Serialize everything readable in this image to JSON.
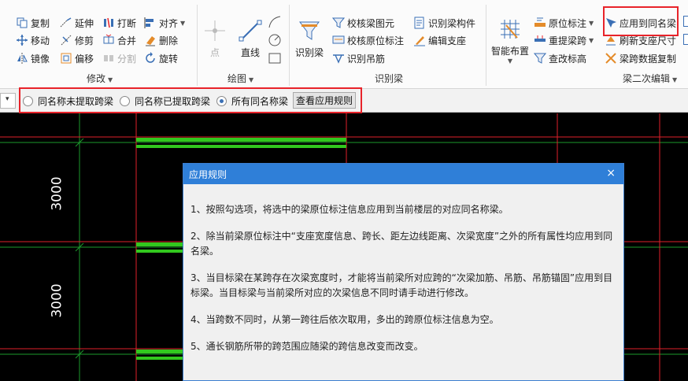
{
  "ribbon": {
    "modify": {
      "copy": "复制",
      "extend": "延伸",
      "break": "打断",
      "align": "对齐",
      "move": "移动",
      "trim": "修剪",
      "merge": "合并",
      "delete": "删除",
      "mirror": "镜像",
      "offset": "偏移",
      "split": "分割",
      "rotate": "旋转",
      "label": "修改"
    },
    "draw": {
      "point": "点",
      "line": "直线",
      "label": "绘图"
    },
    "identify": {
      "identify_beam": "识别梁",
      "check_beam_elem": "校核梁图元",
      "check_orig_label": "校核原位标注",
      "identify_hanger": "识别吊筋",
      "identify_beam_member": "识别梁构件",
      "edit_support": "编辑支座",
      "label": "识别梁"
    },
    "secondary": {
      "smart_layout": "智能布置",
      "orig_label": "原位标注",
      "reextract_span": "重提梁跨",
      "check_elevation": "查改标高",
      "apply_same_name": "应用到同名梁",
      "refresh_support": "刷新支座尺寸",
      "copy_span_data": "梁跨数据复制",
      "label": "梁二次编辑"
    }
  },
  "options": {
    "stub_glyph": "▾",
    "radio1": "同名称未提取跨梁",
    "radio2": "同名称已提取跨梁",
    "radio3": "所有同名称梁",
    "view_rules": "查看应用规则"
  },
  "canvas": {
    "dim1": "3000",
    "dim2": "3000"
  },
  "dialog": {
    "title": "应用规则",
    "close": "×",
    "rule1": "1、按照勾选项，将选中的梁原位标注信息应用到当前楼层的对应同名称梁。",
    "rule2": "2、除当前梁原位标注中“支座宽度信息、跨长、距左边线距离、次梁宽度”之外的所有属性均应用到同名梁。",
    "rule3": "3、当目标梁在某跨存在次梁宽度时，才能将当前梁所对应跨的“次梁加筋、吊筋、吊筋锚固”应用到目标梁。当目标梁与当前梁所对应的次梁信息不同时请手动进行修改。",
    "rule4": "4、当跨数不同时，从第一跨往后依次取用，多出的跨原位标注信息为空。",
    "rule5": "5、通长钢筋所带的跨范围应随梁的跨信息改变而改变。"
  },
  "colors": {
    "accent": "#2f7fd8",
    "highlight": "#e8232a",
    "beam": "#32c81e",
    "grid_red": "#e0202a",
    "grid_green": "#1c9a2c"
  }
}
